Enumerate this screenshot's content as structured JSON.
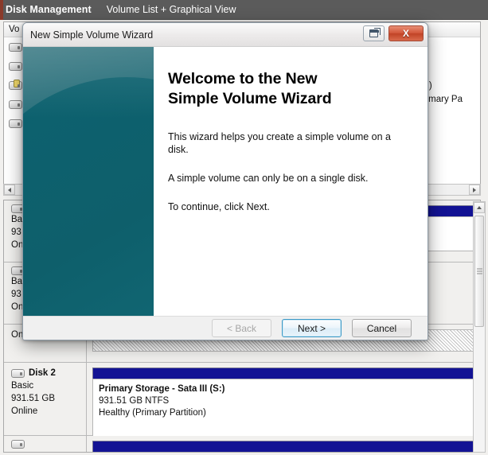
{
  "mmc": {
    "title": "Disk Management",
    "subtitle": "Volume List + Graphical View"
  },
  "volume_pane": {
    "column_header": "Vo",
    "rows": [
      {
        "label": ""
      },
      {
        "label": ""
      },
      {
        "label": ""
      },
      {
        "label": ""
      },
      {
        "label": ""
      }
    ],
    "right_fragments": [
      "ition)",
      ", Primary Pa"
    ]
  },
  "graphical_pane": {
    "obscured_disks": [
      {
        "line1": "Ba",
        "line2": "93",
        "line3": "On"
      },
      {
        "line1": "Ba",
        "line2": "93",
        "line3": "On"
      },
      {
        "line1": "On",
        "line2": "",
        "line3": ""
      }
    ],
    "disks": [
      {
        "name": "Disk 2",
        "type": "Basic",
        "size": "931.51 GB",
        "status": "Online",
        "partition": {
          "name": "Primary Storage - Sata III  (S:)",
          "size": "931.51 GB NTFS",
          "health": "Healthy (Primary Partition)"
        }
      }
    ]
  },
  "wizard": {
    "title": "New Simple Volume Wizard",
    "restore_icon": "restore-icon",
    "close_icon": "close-icon",
    "close_label": "X",
    "heading": "Welcome to the New Simple Volume Wizard",
    "paragraph1": "This wizard helps you create a simple volume on a disk.",
    "paragraph2": "A simple volume can only be on a single disk.",
    "paragraph3": "To continue, click Next.",
    "buttons": {
      "back": "< Back",
      "next": "Next >",
      "cancel": "Cancel"
    }
  },
  "colors": {
    "header_bar": "#5b5b5b",
    "sidebar_teal": "#0d5e6c",
    "partition_blue": "#131394",
    "close_red": "#c14326",
    "default_button_border": "#3c99c6"
  }
}
